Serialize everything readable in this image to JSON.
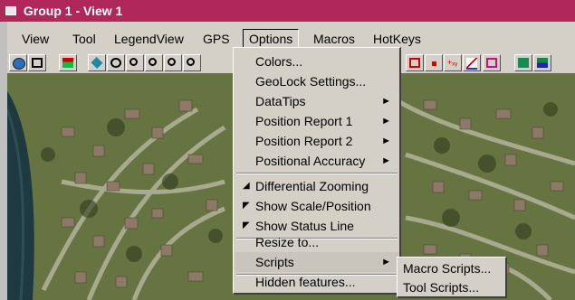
{
  "window": {
    "title": "Group 1 - View 1"
  },
  "menubar": {
    "items": [
      {
        "label": "View"
      },
      {
        "label": "Tool"
      },
      {
        "label": "LegendView"
      },
      {
        "label": "GPS"
      },
      {
        "label": "Options"
      },
      {
        "label": "Macros"
      },
      {
        "label": "HotKeys"
      }
    ]
  },
  "toolbar": {
    "icons": [
      "globe-icon",
      "square-icon",
      "add-layer-icon",
      "diamond-icon",
      "pan-icon",
      "zoom-in-icon",
      "zoom-out-icon",
      "zoom-icon",
      "zoom-extent-icon",
      "layer-icon",
      "point-icon",
      "text-icon",
      "chart-icon",
      "select-icon",
      "map-icon",
      "image-icon"
    ]
  },
  "options_menu": {
    "items": [
      {
        "label": "Colors...",
        "check": "",
        "submenu": false
      },
      {
        "label": "GeoLock Settings...",
        "check": "",
        "submenu": false
      },
      {
        "label": "DataTips",
        "check": "",
        "submenu": true
      },
      {
        "label": "Position Report 1",
        "check": "",
        "submenu": true
      },
      {
        "label": "Position Report 2",
        "check": "",
        "submenu": true
      },
      {
        "label": "Positional Accuracy",
        "check": "",
        "submenu": true
      },
      {
        "label": "Differential Zooming",
        "check": "◢",
        "submenu": false
      },
      {
        "label": "Show Scale/Position",
        "check": "◤",
        "submenu": false
      },
      {
        "label": "Show Status Line",
        "check": "◤",
        "submenu": false
      },
      {
        "label": "Resize to...",
        "check": "",
        "submenu": false
      },
      {
        "label": "Scripts",
        "check": "",
        "submenu": true
      },
      {
        "label": "Hidden features...",
        "check": "",
        "submenu": false
      }
    ],
    "arrow_glyph": "►"
  },
  "scripts_submenu": {
    "items": [
      {
        "label": "Macro Scripts..."
      },
      {
        "label": "Tool Scripts..."
      }
    ]
  },
  "colors": {
    "titlebar": "#b0285a",
    "menu_bg": "#d4d0c8",
    "map_green": "#5f6e3c",
    "lake": "#1e3a40"
  }
}
